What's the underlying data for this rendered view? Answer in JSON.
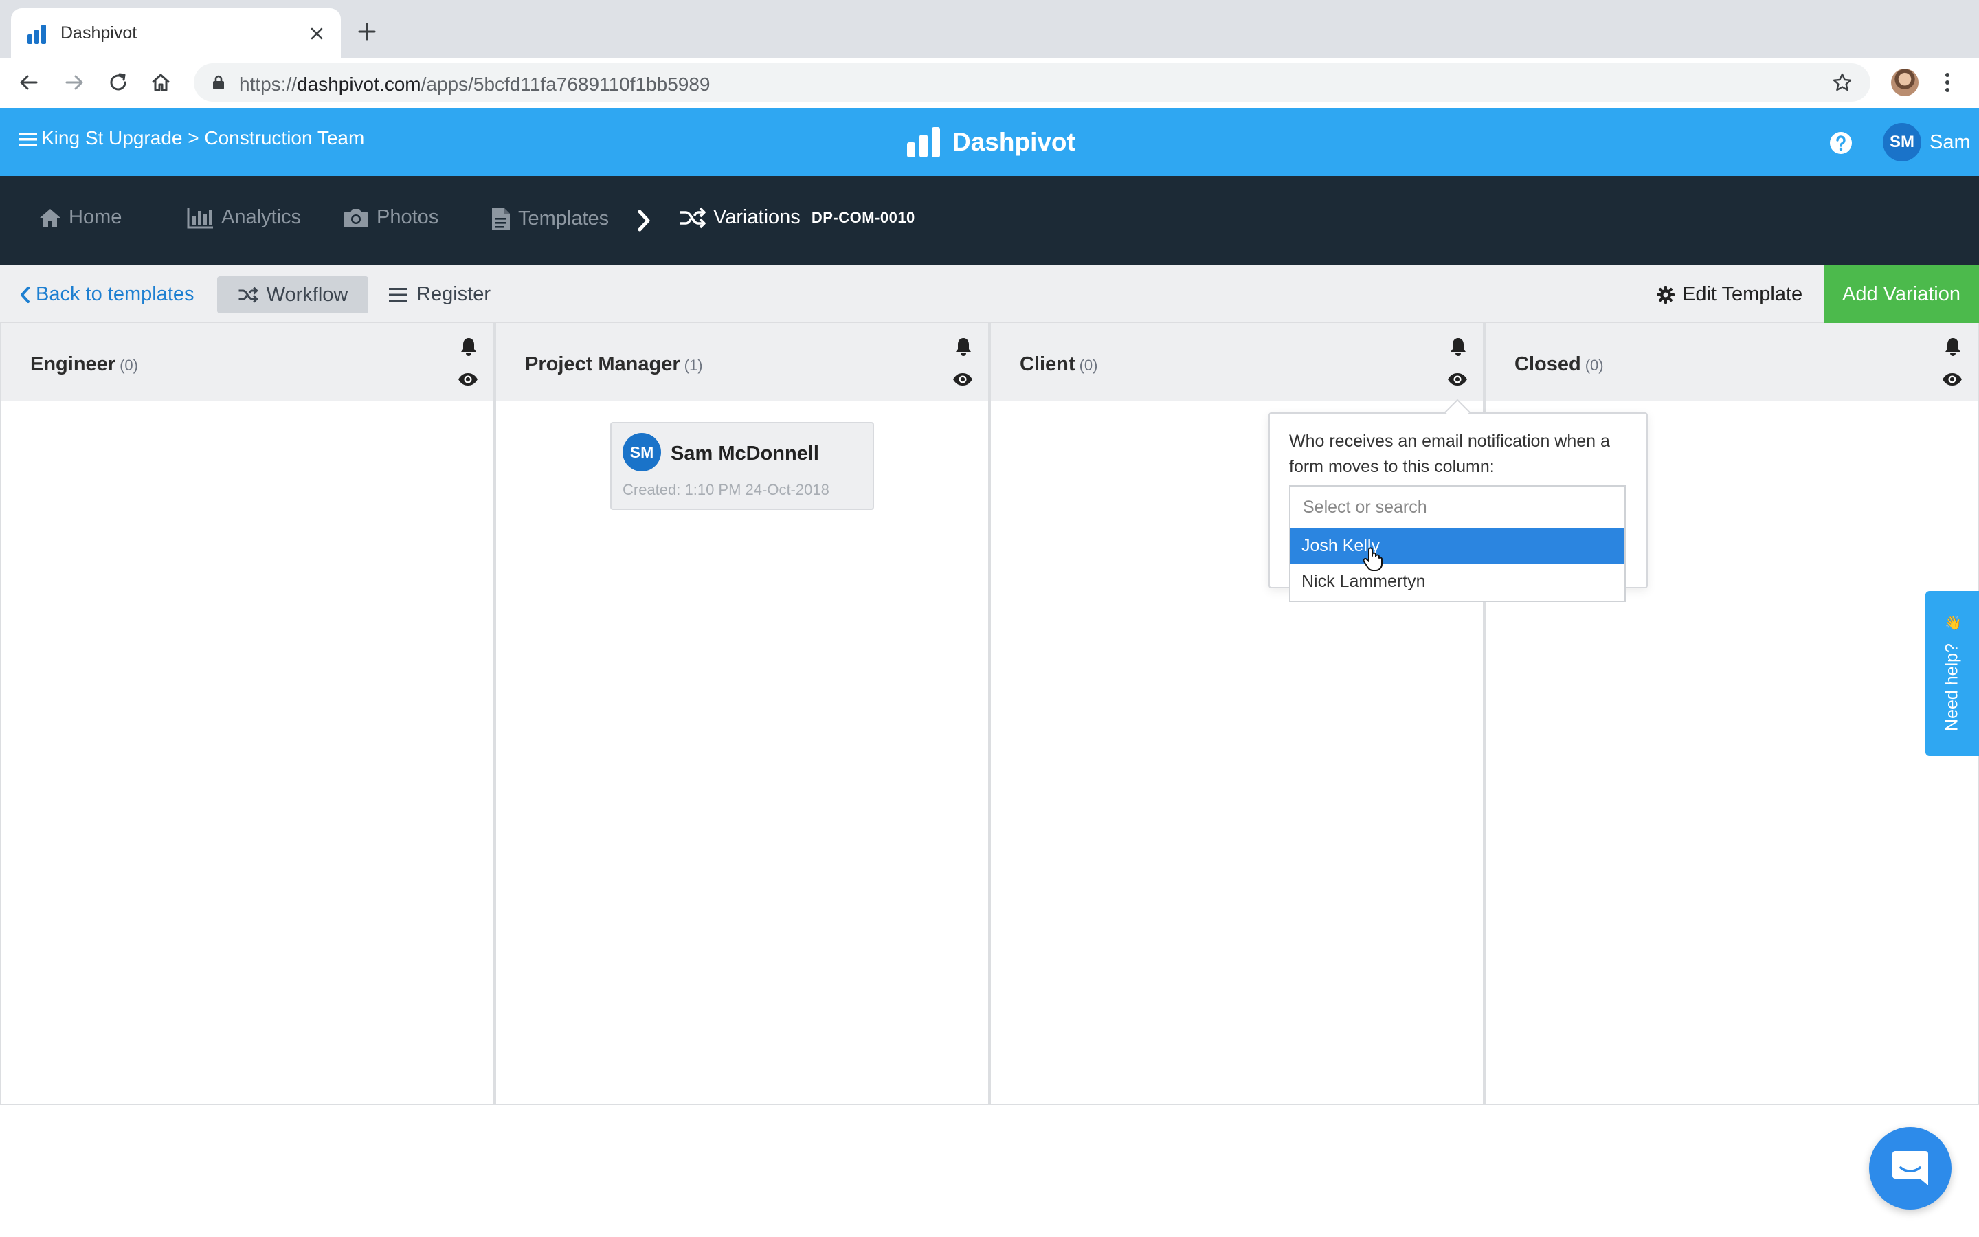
{
  "browser": {
    "tab_title": "Dashpivot",
    "url_prefix": "https://",
    "url_host": "dashpivot.com",
    "url_path": "/apps/5bcfd11fa7689110f1bb5989"
  },
  "header": {
    "breadcrumb": "King St Upgrade > Construction Team",
    "brand": "Dashpivot",
    "avatar_initials": "SM",
    "user_name": "Sam"
  },
  "nav": {
    "home": "Home",
    "analytics": "Analytics",
    "photos": "Photos",
    "templates": "Templates",
    "current": "Variations",
    "form_code": "DP-COM-0010"
  },
  "subbar": {
    "back": "Back to templates",
    "workflow": "Workflow",
    "register": "Register",
    "edit_template": "Edit Template",
    "add_variation": "Add Variation"
  },
  "columns": [
    {
      "title": "Engineer",
      "count": "(0)"
    },
    {
      "title": "Project Manager",
      "count": "(1)"
    },
    {
      "title": "Client",
      "count": "(0)"
    },
    {
      "title": "Closed",
      "count": "(0)"
    }
  ],
  "card": {
    "initials": "SM",
    "name": "Sam McDonnell",
    "created": "Created: 1:10 PM 24-Oct-2018"
  },
  "popover": {
    "text": "Who receives an email notification when a form moves to this column:",
    "placeholder": "Select or search",
    "options": [
      "Josh Kelly",
      "Nick Lammertyn"
    ]
  },
  "help": {
    "label": "Need help?",
    "emoji": "👋"
  },
  "colors": {
    "brand_blue": "#2fa7f2",
    "nav_dark": "#1c2a36",
    "add_green": "#4cba4c",
    "selected_blue": "#2b85e0"
  }
}
